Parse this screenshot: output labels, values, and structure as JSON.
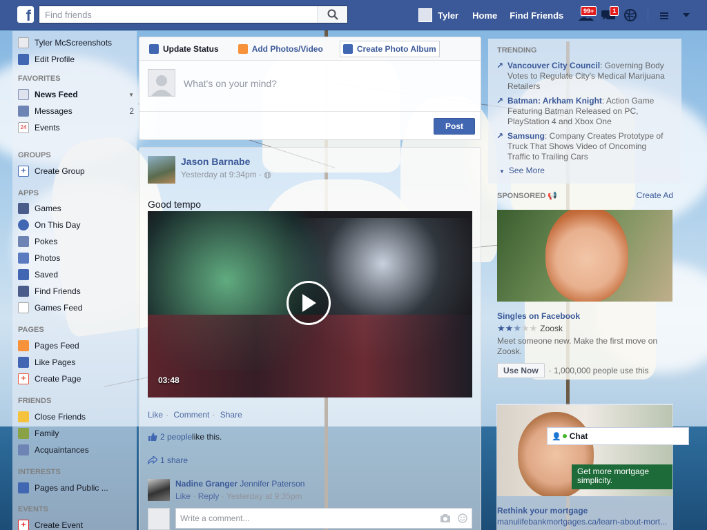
{
  "topbar": {
    "logo": "f",
    "search_placeholder": "Find friends",
    "user_name": "Tyler",
    "home": "Home",
    "find_friends": "Find Friends",
    "friend_requests_badge": "99+",
    "messages_badge": "1"
  },
  "left_nav": {
    "profile_name": "Tyler McScreenshots",
    "edit_profile": "Edit Profile",
    "favorites_header": "FAVORITES",
    "news_feed": "News Feed",
    "messages": "Messages",
    "messages_count": "2",
    "events": "Events",
    "groups_header": "GROUPS",
    "create_group": "Create Group",
    "apps_header": "APPS",
    "games": "Games",
    "on_this_day": "On This Day",
    "pokes": "Pokes",
    "photos": "Photos",
    "saved": "Saved",
    "find_friends": "Find Friends",
    "games_feed": "Games Feed",
    "pages_header": "PAGES",
    "pages_feed": "Pages Feed",
    "like_pages": "Like Pages",
    "create_page": "Create Page",
    "friends_header": "FRIENDS",
    "close_friends": "Close Friends",
    "family": "Family",
    "acquaintances": "Acquaintances",
    "interests_header": "INTERESTS",
    "pages_and_public": "Pages and Public ...",
    "events_header": "EVENTS",
    "create_event": "Create Event"
  },
  "composer": {
    "tab_update_status": "Update Status",
    "tab_add_photos": "Add Photos/Video",
    "tab_create_album": "Create Photo Album",
    "placeholder": "What's on your mind?",
    "post_button": "Post"
  },
  "story": {
    "author": "Jason Barnabe",
    "timestamp": "Yesterday at 9:34pm · ",
    "text": "Good tempo",
    "video_duration": "03:48",
    "like": "Like",
    "comment": "Comment",
    "share": "Share",
    "likes_count": "2 people",
    "likes_suffix": " like this.",
    "shares": "1 share",
    "comment_author": "Nadine Granger",
    "comment_tag": "Jennifer Paterson",
    "comment_like": "Like",
    "comment_reply": "Reply",
    "comment_time": "Yesterday at 9:35pm",
    "write_comment_placeholder": "Write a comment..."
  },
  "trending": {
    "header": "TRENDING",
    "items": [
      {
        "title": "Vancouver City Council",
        "desc": ": Governing Body Votes to Regulate City's Medical Marijuana Retailers"
      },
      {
        "title": "Batman: Arkham Knight",
        "desc": ": Action Game Featuring Batman Released on PC, PlayStation 4 and Xbox One"
      },
      {
        "title": "Samsung",
        "desc": ": Company Creates Prototype of Truck That Shows Video of Oncoming Traffic to Trailing Cars"
      }
    ],
    "see_more": "See More"
  },
  "sponsored": {
    "header": "SPONSORED",
    "create_ad": "Create Ad",
    "ad1_title": "Singles on Facebook",
    "ad1_rating": 2.5,
    "ad1_brand": "Zoosk",
    "ad1_desc": "Meet someone new. Make the first move on Zoosk.",
    "ad1_button": "Use Now",
    "ad1_users": "· 1,000,000 people use this",
    "ad2_banner": "Get more mortgage simplicity.",
    "ad2_title": "Rethink your mortgage",
    "ad2_url": "manulifebankmortgages.ca/learn-about-mort..."
  },
  "chat": {
    "label": "Chat"
  },
  "colors": {
    "brand": "#3b5998",
    "badge": "#e41c1c"
  }
}
